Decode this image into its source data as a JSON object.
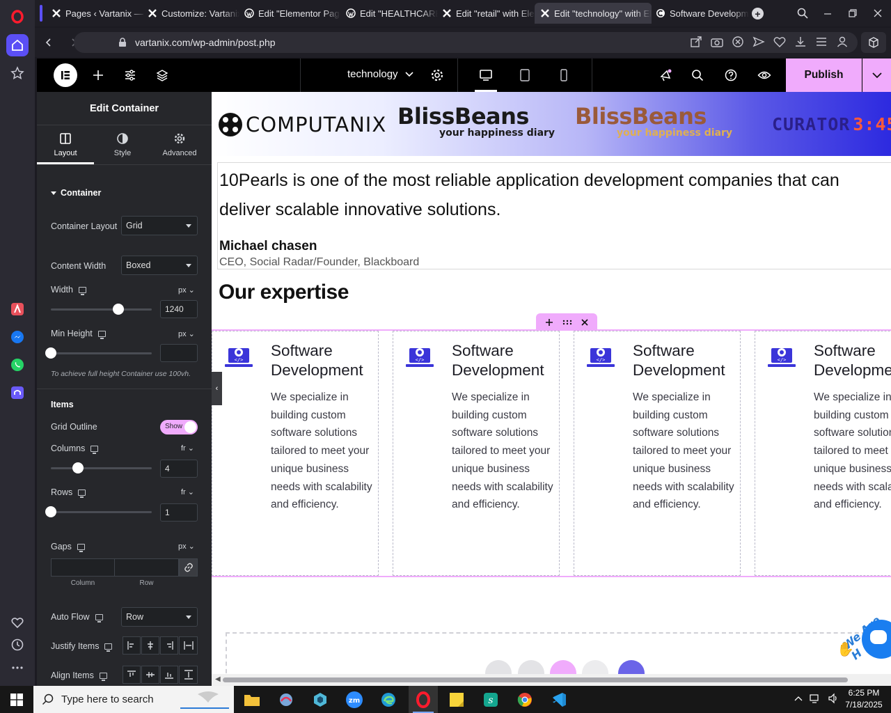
{
  "browser": {
    "tabs": [
      {
        "title": "Pages ‹ Vartanix — W",
        "icon": "elementor-x-icon",
        "active": false
      },
      {
        "title": "Customize: Vartanix",
        "icon": "elementor-x-icon",
        "active": false
      },
      {
        "title": "Edit \"Elementor Page",
        "icon": "wordpress-icon",
        "active": false
      },
      {
        "title": "Edit \"HEALTHCARE\"",
        "icon": "wordpress-icon",
        "active": false
      },
      {
        "title": "Edit \"retail\" with Ele",
        "icon": "elementor-x-icon",
        "active": false
      },
      {
        "title": "Edit \"technology\" with Ele",
        "icon": "elementor-x-icon",
        "active": true
      },
      {
        "title": "Software Developme",
        "icon": "site-favicon-icon",
        "active": false
      }
    ],
    "url": "vartanix.com/wp-admin/post.php"
  },
  "elementor_topbar": {
    "page_name": "technology",
    "publish_label": "Publish"
  },
  "panel": {
    "title": "Edit Container",
    "tabs": [
      "Layout",
      "Style",
      "Advanced"
    ],
    "section_title": "Container",
    "container_layout_label": "Container Layout",
    "container_layout_value": "Grid",
    "content_width_label": "Content Width",
    "content_width_value": "Boxed",
    "width_label": "Width",
    "width_unit": "px",
    "width_value": "1240",
    "width_slider_fraction": 0.67,
    "min_height_label": "Min Height",
    "min_height_unit": "px",
    "min_height_value": "",
    "min_height_slider_fraction": 0,
    "min_height_hint": "To achieve full height Container use 100vh.",
    "items_heading": "Items",
    "grid_outline_label": "Grid Outline",
    "grid_outline_toggle": "Show",
    "columns_label": "Columns",
    "columns_unit": "fr",
    "columns_value": "4",
    "columns_slider_fraction": 0.27,
    "rows_label": "Rows",
    "rows_unit": "fr",
    "rows_value": "1",
    "rows_slider_fraction": 0,
    "gaps_label": "Gaps",
    "gaps_unit": "px",
    "gap_column_label": "Column",
    "gap_row_label": "Row",
    "auto_flow_label": "Auto Flow",
    "auto_flow_value": "Row",
    "justify_items_label": "Justify Items",
    "align_items_label": "Align Items"
  },
  "canvas": {
    "logos": [
      "COMPUTANIX",
      "BlissBeans",
      "your happiness diary",
      "BlissBeans",
      "your happiness diary",
      "CURATOR",
      "3:45"
    ],
    "testimonial_quote": "10Pearls is one of the most reliable application development companies that can deliver scalable innovative solutions.",
    "testimonial_name": "Michael chasen",
    "testimonial_role": "CEO, Social Radar/Founder, Blackboard",
    "expertise_heading": "Our expertise",
    "cards": [
      {
        "title": "Software Development",
        "text": "We specialize in building custom software solutions tailored to meet your unique business needs with scalability and efficiency."
      },
      {
        "title": "Software Development",
        "text": "We specialize in building custom software solutions tailored to meet your unique business needs with scalability and efficiency."
      },
      {
        "title": "Software Development",
        "text": "We specialize in building custom software solutions tailored to meet your unique business needs with scalability and efficiency."
      },
      {
        "title": "Software Development",
        "text": "We specialize in building custom software solutions tailored to meet your unique business needs with scalability and efficiency."
      }
    ],
    "badge_text": "We Are H"
  },
  "taskbar": {
    "search_placeholder": "Type here to search",
    "time": "6:25 PM",
    "date": "7/18/2025"
  },
  "colors": {
    "accent": "#f0abfc",
    "card_icon": "#3b35d9",
    "publish_bg": "#f0abfc"
  }
}
